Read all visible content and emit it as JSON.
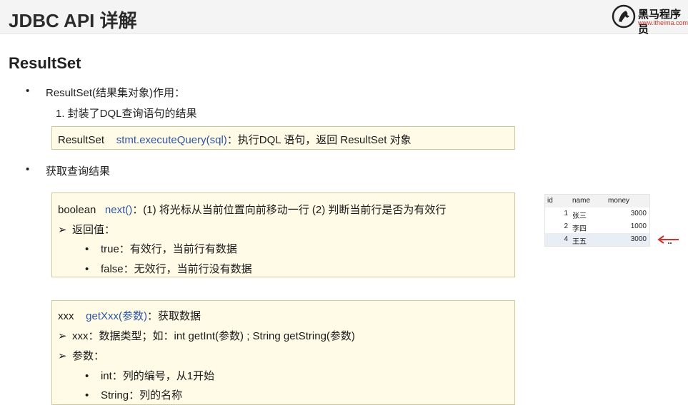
{
  "header": {
    "title": "JDBC API 详解",
    "logo": {
      "name": "黑马程序员",
      "url": "www.itheima.com"
    }
  },
  "section": {
    "title": "ResultSet",
    "bullet1": "ResultSet(结果集对象)作用：",
    "numbered1": "1.   封装了DQL查询语句的结果",
    "box1": {
      "prefix": "ResultSet",
      "method": "stmt.executeQuery(sql)",
      "suffix": "：执行DQL 语句，返回 ResultSet 对象"
    },
    "bullet2": "获取查询结果",
    "box2": {
      "prefix": "boolean",
      "method": "next()",
      "suffix": "：(1) 将光标从当前位置向前移动一行   (2) 判断当前行是否为有效行",
      "subhead": "返回值：",
      "items": [
        "true：有效行，当前行有数据",
        "false：无效行，当前行没有数据"
      ]
    },
    "box3": {
      "prefix": "xxx",
      "method": "getXxx(参数)",
      "suffix": "：获取数据",
      "line2": "xxx：数据类型；如：int getInt(参数) ; String getString(参数)",
      "subhead": "参数：",
      "items": [
        "int：列的编号，从1开始",
        "String：列的名称"
      ]
    }
  },
  "table": {
    "columns": [
      "id",
      "name",
      "money"
    ],
    "rows": [
      {
        "id": "1",
        "name": "张三",
        "money": "3000"
      },
      {
        "id": "2",
        "name": "李四",
        "money": "1000"
      },
      {
        "id": "4",
        "name": "王五",
        "money": "3000"
      }
    ]
  },
  "colors": {
    "box_background": "#fffbe6",
    "method_blue": "#2d55a0",
    "arrow_red": "#d0312d"
  },
  "icons": [
    "horse-logo-icon",
    "bullet-dot-icon",
    "arrow-bullet-icon",
    "red-arrow-icon"
  ]
}
